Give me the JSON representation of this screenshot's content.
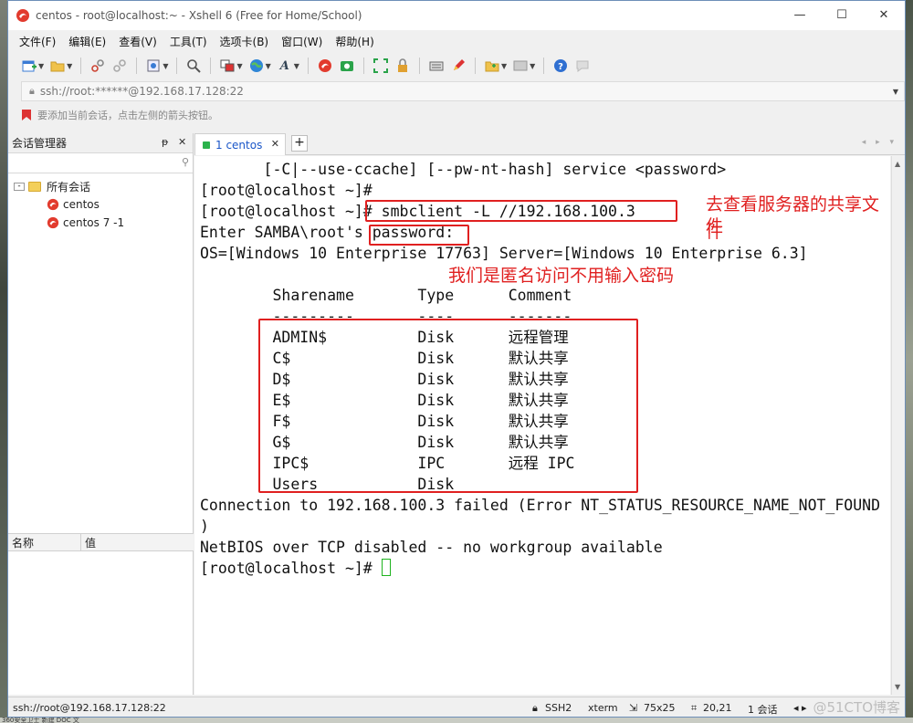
{
  "window": {
    "title": "centos - root@localhost:~ - Xshell 6 (Free for Home/School)",
    "controls": [
      "—",
      "☐",
      "✕"
    ]
  },
  "menu": [
    "文件(F)",
    "编辑(E)",
    "查看(V)",
    "工具(T)",
    "选项卡(B)",
    "窗口(W)",
    "帮助(H)"
  ],
  "address": {
    "value": "ssh://root:******@192.168.17.128:22"
  },
  "hint": "要添加当前会话，点击左侧的箭头按钮。",
  "session_panel": {
    "title": "会话管理器",
    "pin": "ᵽ",
    "close": "✕",
    "root": "所有会话",
    "items": [
      "centos",
      "centos 7 -1"
    ],
    "prop_headers": [
      "名称",
      "值"
    ]
  },
  "tab": {
    "label": "1 centos",
    "close": "✕",
    "add": "+",
    "nav": "◂ ▸ ▾"
  },
  "terminal": {
    "lines": [
      "       [-C|--use-ccache] [--pw-nt-hash] service <password>",
      "[root@localhost ~]#",
      "[root@localhost ~]# smbclient -L //192.168.100.3",
      "Enter SAMBA\\root's password:",
      "OS=[Windows 10 Enterprise 17763] Server=[Windows 10 Enterprise 6.3]",
      "",
      "        Sharename       Type      Comment",
      "        ---------       ----      -------",
      "        ADMIN$          Disk      远程管理",
      "        C$              Disk      默认共享",
      "        D$              Disk      默认共享",
      "        E$              Disk      默认共享",
      "        F$              Disk      默认共享",
      "        G$              Disk      默认共享",
      "        IPC$            IPC       远程 IPC",
      "        Users           Disk",
      "Connection to 192.168.100.3 failed (Error NT_STATUS_RESOURCE_NAME_NOT_FOUND",
      ")",
      "NetBIOS over TCP disabled -- no workgroup available",
      "[root@localhost ~]# "
    ],
    "annotations": {
      "query": "去查看服务器的共享文件",
      "query_wrap": "件",
      "anon": "我们是匿名访问不用输入密码"
    }
  },
  "status": {
    "address": "ssh://root@192.168.17.128:22",
    "protocol": "SSH2",
    "term": "xterm",
    "size": "75x25",
    "pos": "20,21",
    "sessions": "1 会话",
    "nav": "◂ ▸"
  },
  "watermark": "@51CTO博客",
  "taskbar_text": "360安全卫士 新建 DOC 文"
}
